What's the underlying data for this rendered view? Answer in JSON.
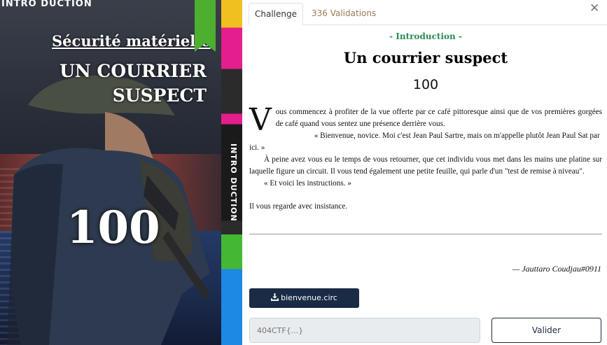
{
  "card": {
    "banner": "INTRO",
    "banner_suffix": "DUCTION",
    "subtitle": "Sécurité matérielle",
    "title_line1": "UN COURRIER",
    "title_line2": "SUSPECT",
    "points": "100",
    "spine_label": "INTRO DUCTION",
    "colors": {
      "ribbon": "#4caf30",
      "spine_yellow": "#f0c020",
      "spine_pink": "#e41e8c",
      "spine_green": "#44b734",
      "spine_blue": "#1e88e5"
    }
  },
  "tabs": [
    {
      "label": "Challenge",
      "active": true
    },
    {
      "label": "336 Validations",
      "active": false
    }
  ],
  "close_icon": "close-icon",
  "challenge": {
    "category": "- Introduction -",
    "title": "Un courrier suspect",
    "points": "100",
    "dropcap": "V",
    "paragraphs": [
      "ous commencez à profiter de la vue offerte par ce café pittoresque ainsi que de vos premières gorgées de café quand vous sentez une présence derrière vous.",
      "« Bienvenue, novice. Moi c'est Jean Paul Sartre, mais on m'appelle plutôt Jean Paul Sat par ici. »",
      "À peine avez vous eu le temps de vous retourner, que cet individu vous met dans les mains une platine sur laquelle figure un circuit. Il vous tend également une petite feuille, qui parle d'un \"test de remise à niveau\".",
      "« Et voici les instructions. »",
      "Il vous regarde avec insistance."
    ],
    "author": "— Jauttaro Coudjau#0911",
    "download_label": "bienvenue.circ",
    "flag_placeholder": "404CTF{...}",
    "validate_label": "Valider"
  }
}
